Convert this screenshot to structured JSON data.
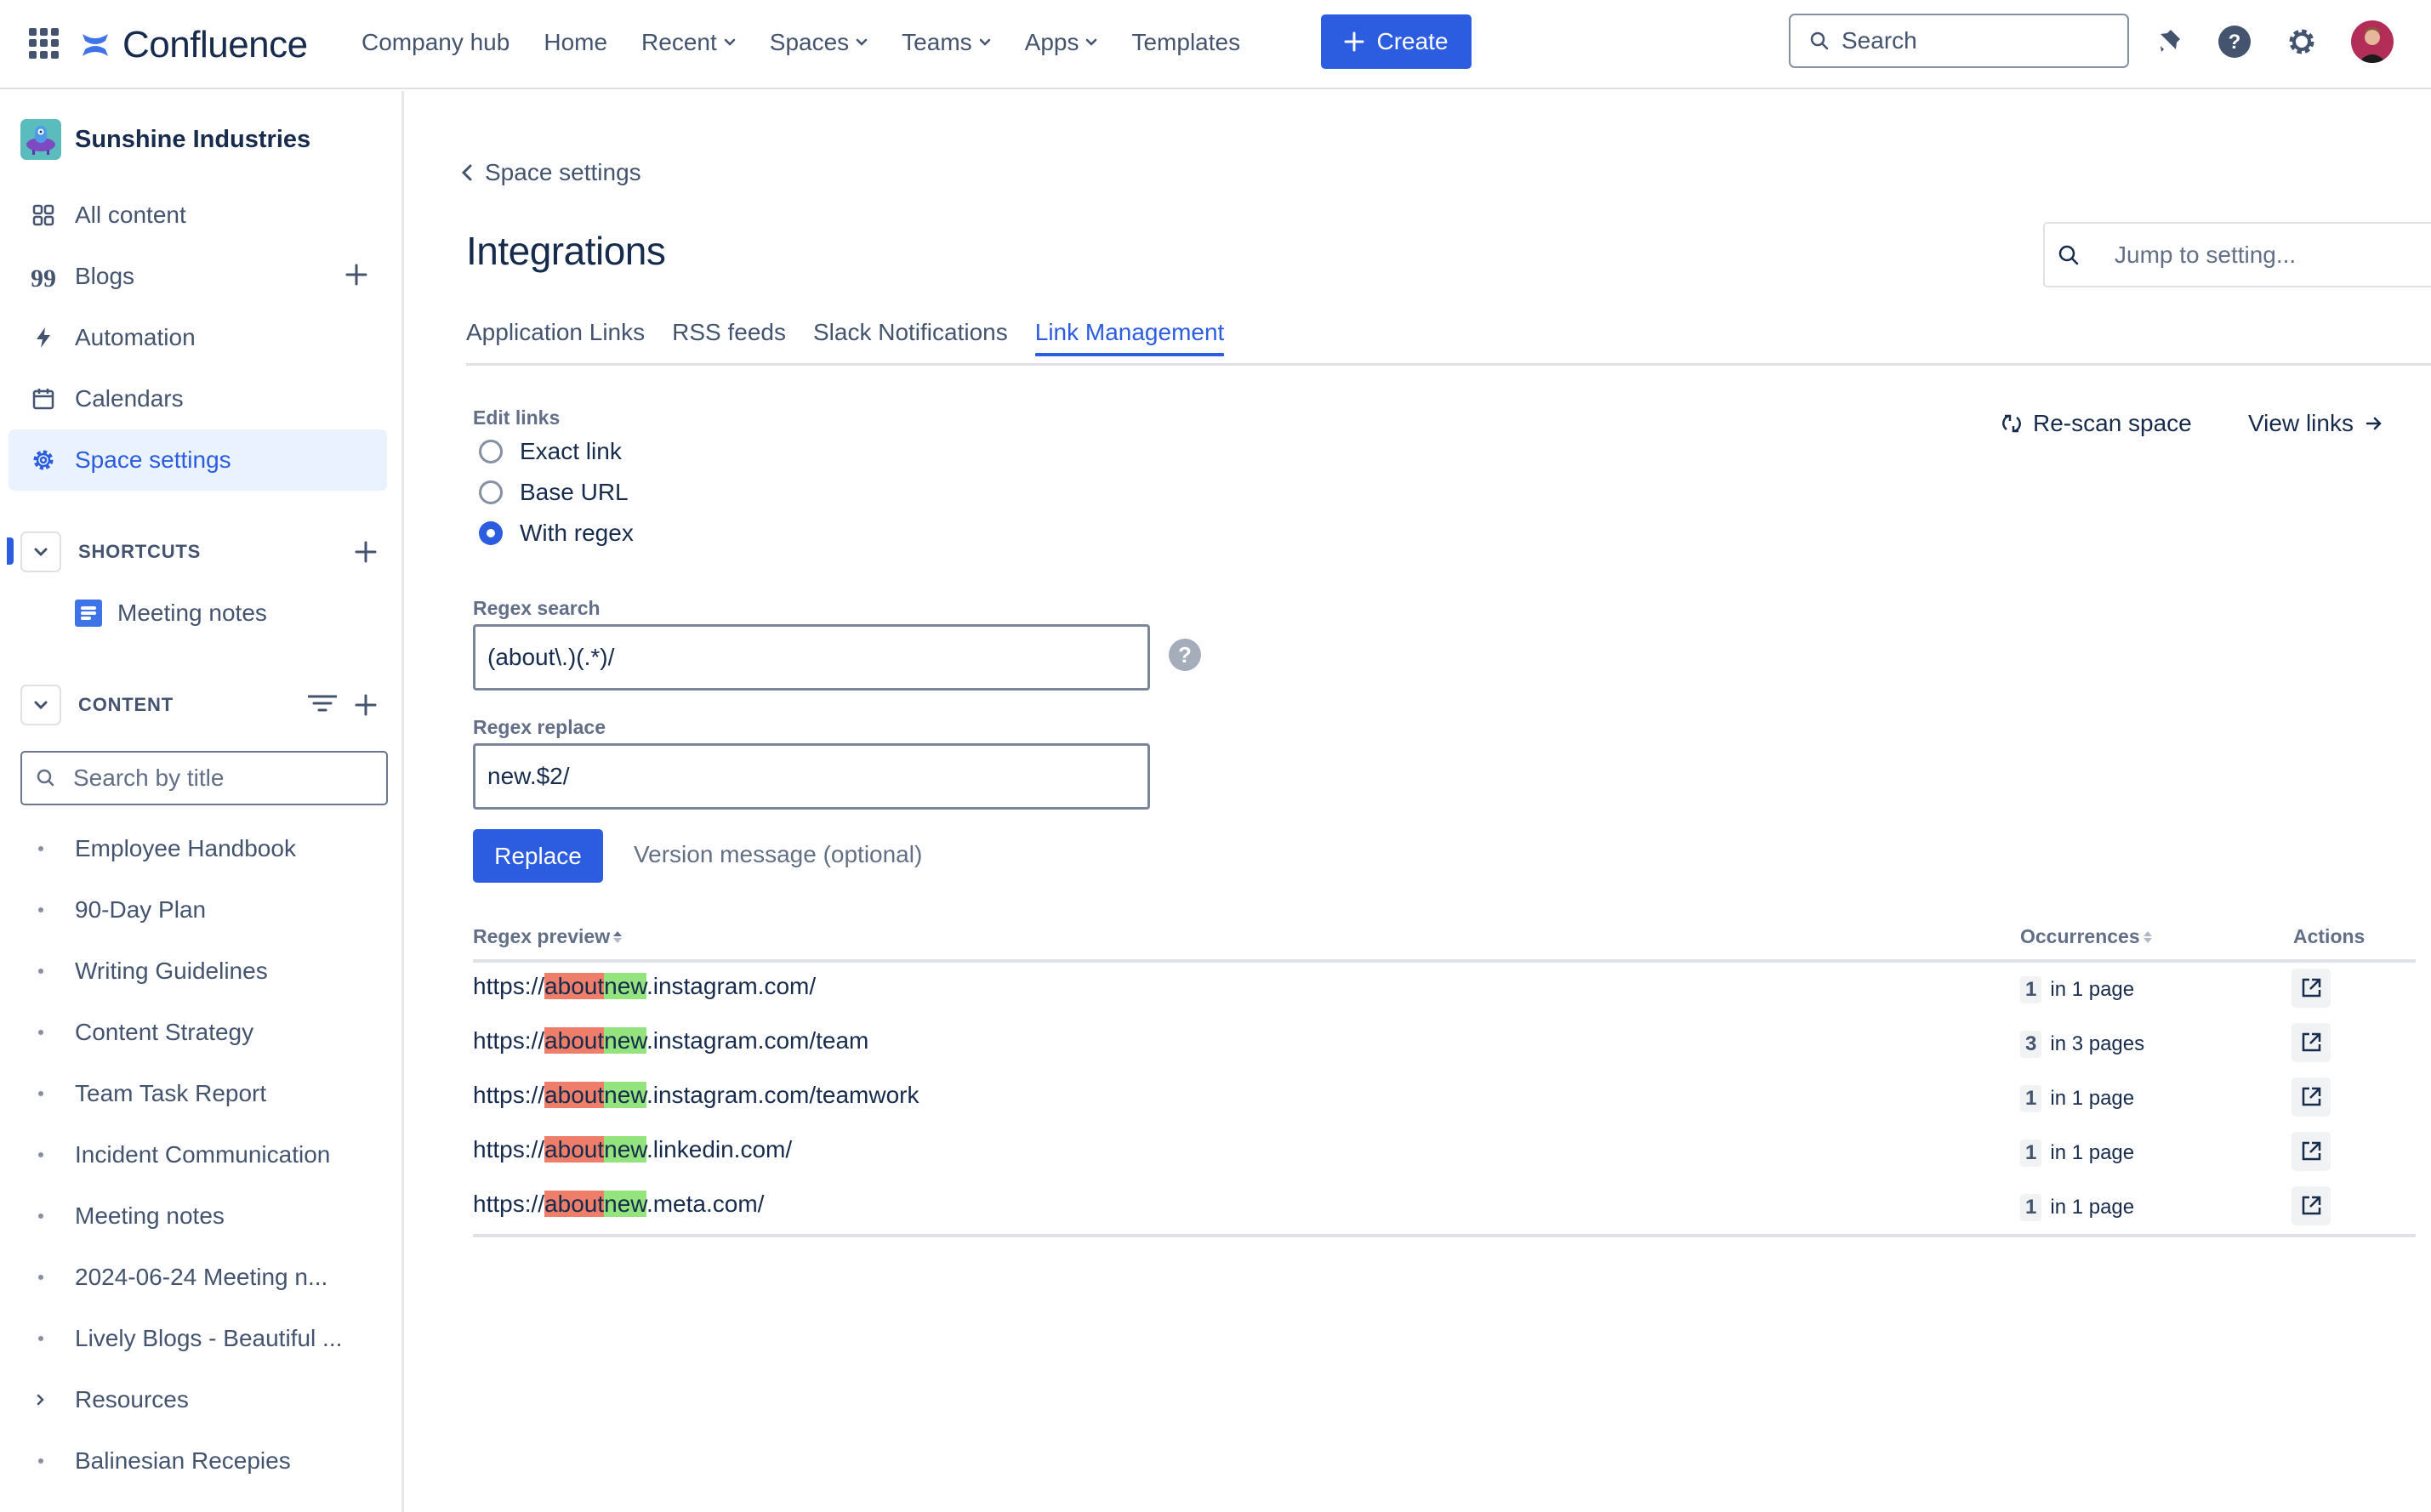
{
  "header": {
    "app_name": "Confluence",
    "nav": [
      {
        "label": "Company hub",
        "dropdown": false
      },
      {
        "label": "Home",
        "dropdown": false
      },
      {
        "label": "Recent",
        "dropdown": true
      },
      {
        "label": "Spaces",
        "dropdown": true
      },
      {
        "label": "Teams",
        "dropdown": true
      },
      {
        "label": "Apps",
        "dropdown": true
      },
      {
        "label": "Templates",
        "dropdown": false
      }
    ],
    "create_label": "Create",
    "search_placeholder": "Search",
    "icons": [
      "notifications-icon",
      "help-icon",
      "settings-icon",
      "avatar"
    ]
  },
  "sidebar": {
    "space_name": "Sunshine Industries",
    "items": [
      {
        "label": "All content",
        "icon": "grid-icon"
      },
      {
        "label": "Blogs",
        "icon": "quote-icon",
        "add": true
      },
      {
        "label": "Automation",
        "icon": "lightning-icon"
      },
      {
        "label": "Calendars",
        "icon": "calendar-icon"
      },
      {
        "label": "Space settings",
        "icon": "gear-icon",
        "active": true
      }
    ],
    "shortcuts": {
      "title": "SHORTCUTS",
      "items": [
        {
          "label": "Meeting notes",
          "icon": "page-icon"
        }
      ]
    },
    "content": {
      "title": "CONTENT",
      "search_placeholder": "Search by title",
      "tree": [
        {
          "label": "Employee Handbook",
          "expandable": false
        },
        {
          "label": "90-Day Plan",
          "expandable": false
        },
        {
          "label": "Writing Guidelines",
          "expandable": false
        },
        {
          "label": "Content Strategy",
          "expandable": false
        },
        {
          "label": "Team Task Report",
          "expandable": false
        },
        {
          "label": "Incident Communication",
          "expandable": false
        },
        {
          "label": "Meeting notes",
          "expandable": false
        },
        {
          "label": "2024-06-24 Meeting n...",
          "expandable": false
        },
        {
          "label": "Lively Blogs - Beautiful ...",
          "expandable": false
        },
        {
          "label": "Resources",
          "expandable": true
        },
        {
          "label": "Balinesian Recepies",
          "expandable": false
        }
      ]
    }
  },
  "main": {
    "back_label": "Space settings",
    "title": "Integrations",
    "jump_placeholder": "Jump to setting...",
    "tabs": [
      {
        "label": "Application Links",
        "active": false
      },
      {
        "label": "RSS feeds",
        "active": false
      },
      {
        "label": "Slack Notifications",
        "active": false
      },
      {
        "label": "Link Management",
        "active": true
      }
    ],
    "rescan_label": "Re-scan space",
    "view_links_label": "View links",
    "edit_links": {
      "label": "Edit links",
      "options": [
        {
          "label": "Exact link",
          "checked": false
        },
        {
          "label": "Base URL",
          "checked": false
        },
        {
          "label": "With regex",
          "checked": true
        }
      ]
    },
    "regex_search": {
      "label": "Regex search",
      "value": "(about\\.)(.*)/"
    },
    "regex_replace": {
      "label": "Regex replace",
      "value": "new.$2/"
    },
    "replace_label": "Replace",
    "version_message_placeholder": "Version message (optional)",
    "table": {
      "columns": [
        "Regex preview",
        "Occurrences",
        "Actions"
      ],
      "rows": [
        {
          "prefix": "https://",
          "old": "about",
          "new": "new",
          "suffix": ".instagram.com/",
          "count": "1",
          "pages": "in 1 page"
        },
        {
          "prefix": "https://",
          "old": "about",
          "new": "new",
          "suffix": ".instagram.com/team",
          "count": "3",
          "pages": "in 3 pages"
        },
        {
          "prefix": "https://",
          "old": "about",
          "new": "new",
          "suffix": ".instagram.com/teamwork",
          "count": "1",
          "pages": "in 1 page"
        },
        {
          "prefix": "https://",
          "old": "about",
          "new": "new",
          "suffix": ".linkedin.com/",
          "count": "1",
          "pages": "in 1 page"
        },
        {
          "prefix": "https://",
          "old": "about",
          "new": "new",
          "suffix": ".meta.com/",
          "count": "1",
          "pages": "in 1 page"
        }
      ]
    }
  },
  "colors": {
    "brand": "#2c5ce0",
    "removed_highlight": "#ee7e69",
    "added_highlight": "#94e47e",
    "text": "#172b4d",
    "subtle": "#44546f"
  }
}
